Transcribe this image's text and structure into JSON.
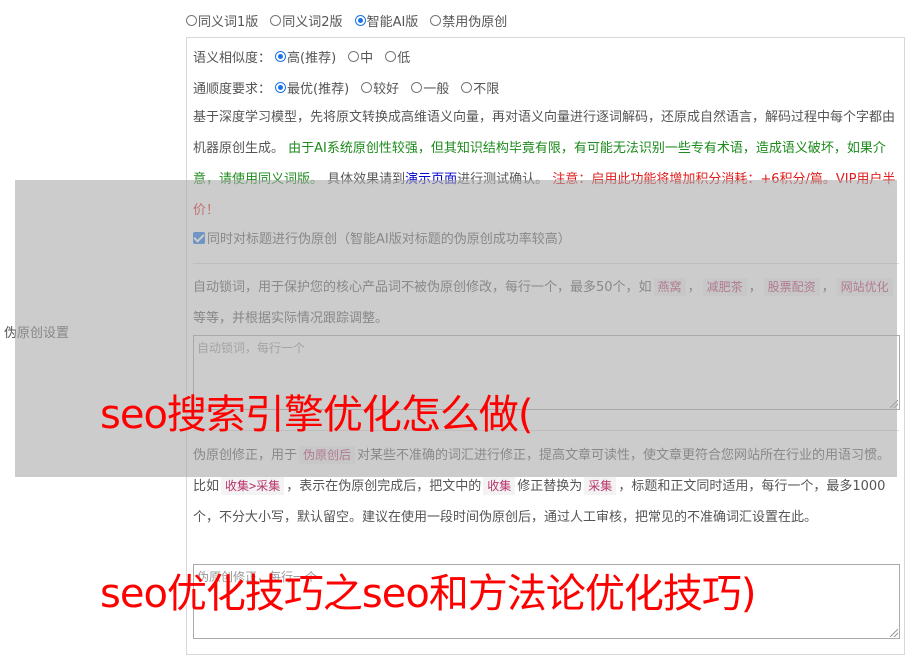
{
  "mode_options": [
    {
      "label": "同义词1版",
      "checked": false
    },
    {
      "label": "同义词2版",
      "checked": false
    },
    {
      "label": "智能AI版",
      "checked": true
    },
    {
      "label": "禁用伪原创",
      "checked": false
    }
  ],
  "similarity": {
    "label": "语义相似度：",
    "options": [
      {
        "label": "高(推荐)",
        "checked": true
      },
      {
        "label": "中",
        "checked": false
      },
      {
        "label": "低",
        "checked": false
      }
    ]
  },
  "fluency": {
    "label": "通顺度要求：",
    "options": [
      {
        "label": "最优(推荐)",
        "checked": true
      },
      {
        "label": "较好",
        "checked": false
      },
      {
        "label": "一般",
        "checked": false
      },
      {
        "label": "不限",
        "checked": false
      }
    ]
  },
  "description": {
    "part1": "基于深度学习模型，先将原文转换成高维语义向量，再对语义向量进行逐词解码，还原成自然语言，解码过程中每个字都由机器原创生成。 ",
    "part2_green": "由于AI系统原创性较强，但其知识结构毕竟有限，有可能无法识别一些专有术语，造成语义破坏，如果介意，请使用同义词版。",
    "part3": " 具体效果请到",
    "link": "演示页面",
    "part4": "进行测试确认。 ",
    "part5_red": "注意：启用此功能将增加积分消耗：+6积分/篇。VIP用户半价！"
  },
  "title_checkbox": {
    "label": "同时对标题进行伪原创（智能AI版对标题的伪原创成功率较高）",
    "checked": true
  },
  "lock_words": {
    "text1": "自动锁词，用于保护您的核心产品词不被伪原创修改，每行一个，最多50个，如",
    "tags": [
      "燕窝",
      "减肥茶",
      "股票配资",
      "网站优化"
    ],
    "text2": "等等，并根据实际情况跟踪调整。",
    "placeholder": "自动锁词，每行一个"
  },
  "correction": {
    "text1": "伪原创修正，用于",
    "tag1": "伪原创后",
    "text2": "对某些不准确的词汇进行修正，提高文章可读性，使文章更符合您网站所在行业的用语习惯。比如",
    "tag2": "收集>采集",
    "text3": "，表示在伪原创完成后，把文中的",
    "tag3": "收集",
    "text4": "修正替换为",
    "tag4": "采集",
    "text5": "，标题和正文同时适用，每行一个，最多1000个，不分大小写，默认留空。建议在使用一段时间伪原创后，通过人工审核，把常见的不准确词汇设置在此。",
    "placeholder": "伪原创修正，每行一个"
  },
  "side_label": "伪原创设置",
  "overlay_texts": {
    "line1": "seo搜索引擎优化怎么做(",
    "line2": "seo优化技巧之seo和方法论优化技巧)"
  },
  "colors": {
    "accent": "#1a73e8",
    "green": "#1c8a1c",
    "red": "#e11b1b",
    "overlay_text": "#ff0000"
  }
}
